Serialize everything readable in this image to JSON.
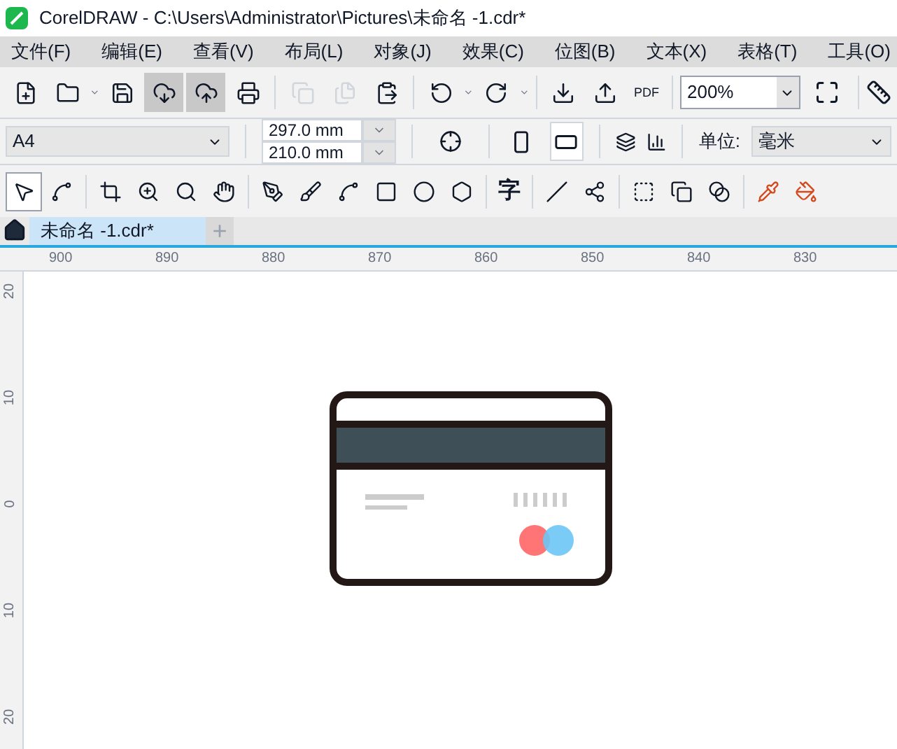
{
  "window": {
    "title": "CorelDRAW - C:\\Users\\Administrator\\Pictures\\未命名 -1.cdr*"
  },
  "menu": [
    "文件(F)",
    "编辑(E)",
    "查看(V)",
    "布局(L)",
    "对象(J)",
    "效果(C)",
    "位图(B)",
    "文本(X)",
    "表格(T)",
    "工具(O)"
  ],
  "toolbar": [
    {
      "pressed": false,
      "disabled": false
    },
    {
      "pressed": false,
      "disabled": false
    },
    {
      "pressed": false,
      "disabled": false
    },
    {
      "pressed": true,
      "disabled": false
    },
    {
      "pressed": true,
      "disabled": false
    },
    {
      "pressed": false,
      "disabled": false
    },
    {
      "pressed": false,
      "disabled": true
    },
    {
      "pressed": false,
      "disabled": true
    },
    {
      "pressed": false,
      "disabled": false
    },
    {
      "pressed": false,
      "disabled": false
    },
    {
      "pressed": false,
      "disabled": false
    },
    {
      "pressed": false,
      "disabled": false
    },
    {
      "pressed": false,
      "disabled": false
    }
  ],
  "pdf_label": "PDF",
  "zoom": "200%",
  "property_bar": {
    "page_size": "A4",
    "width": "297.0 mm",
    "height": "210.0 mm",
    "units_label": "单位:",
    "units": "毫米",
    "landscape": true
  },
  "toolbox": {
    "text_tool": "字",
    "tools": [
      {
        "selected": true
      },
      {
        "selected": false
      },
      {
        "selected": false
      },
      {
        "selected": false
      },
      {
        "selected": false
      },
      {
        "selected": false
      },
      {
        "selected": false
      },
      {
        "selected": false
      },
      {
        "selected": false
      },
      {
        "selected": false
      },
      {
        "selected": false
      },
      {
        "selected": false
      },
      {
        "selected": false
      },
      {
        "selected": false
      },
      {
        "selected": false
      },
      {
        "selected": false
      },
      {
        "selected": false
      },
      {
        "selected": false
      },
      {
        "selected": false
      }
    ]
  },
  "tabs": [
    {
      "label": "未命名 -1.cdr*",
      "selected": true
    }
  ],
  "new_tab": "+",
  "ruler": {
    "horizontal": [
      "900",
      "890",
      "880",
      "870",
      "860",
      "850",
      "840",
      "830"
    ],
    "vertical": [
      "20",
      "10",
      "0",
      "10",
      "20"
    ]
  }
}
